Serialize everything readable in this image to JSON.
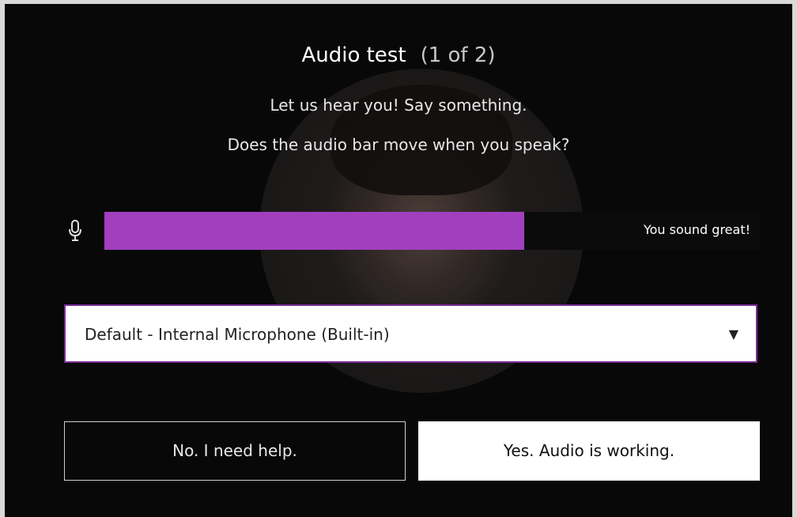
{
  "dialog": {
    "title": "Audio test",
    "step": "(1 of 2)",
    "instruction_line1": "Let us hear you! Say something.",
    "instruction_line2": "Does the audio bar move when you speak?"
  },
  "audio_meter": {
    "level": 0.64,
    "status_text": "You sound great!",
    "icon": "microphone-icon",
    "fill_color": "#a23fbf"
  },
  "microphone_select": {
    "selected": "Default - Internal Microphone (Built-in)",
    "arrow": "▼"
  },
  "buttons": {
    "no_label": "No. I need help.",
    "yes_label": "Yes. Audio is working."
  }
}
